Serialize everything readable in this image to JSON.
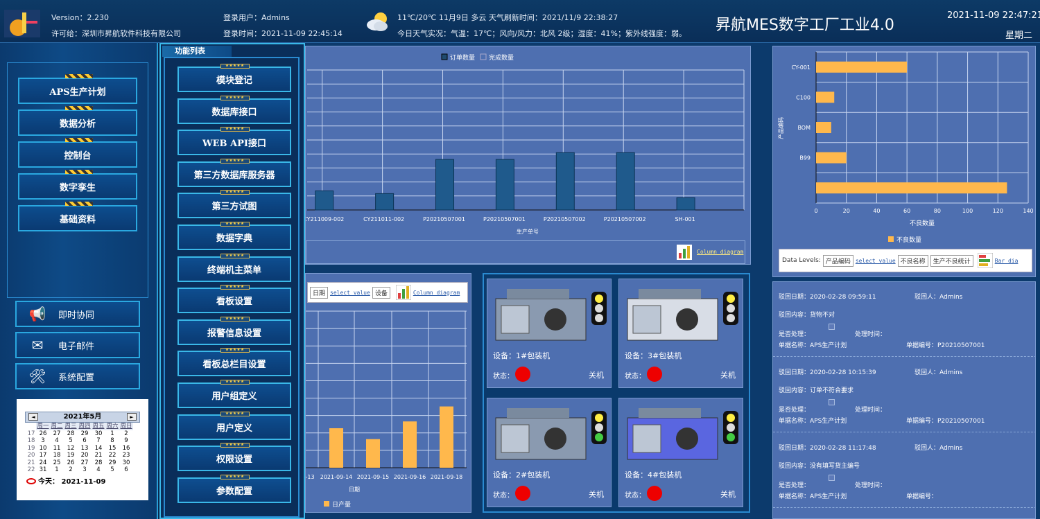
{
  "header": {
    "version": "Version：2.230",
    "license": "许可给：深圳市昇航软件科技有限公司",
    "login_user": "登录用户：Admins",
    "login_time": "登录时间：2021-11-09 22:45:14",
    "weather_line1": "11℃/20℃  11月9日 多云    天气刷新时间：2021/11/9 22:38:27",
    "weather_line2": "今日天气实况：气温：17℃；风向/风力：北风 2级；湿度：41%；紫外线强度：弱。",
    "title": "昇航MES数字工厂工业4.0",
    "datetime": "2021-11-09 22:47:21",
    "weekday": "星期二"
  },
  "left_menu": [
    {
      "label": "APS生产计划"
    },
    {
      "label": "数据分析"
    },
    {
      "label": "控制台"
    },
    {
      "label": "数字孪生"
    },
    {
      "label": "基础资料"
    }
  ],
  "left_actions": [
    {
      "label": "即时协同",
      "icon": "megaphone-icon"
    },
    {
      "label": "电子邮件",
      "icon": "envelope-icon"
    },
    {
      "label": "系统配置",
      "icon": "tools-icon"
    }
  ],
  "calendar": {
    "month_label": "2021年5月",
    "prev": "◄",
    "next": "►",
    "day_headers": [
      "周一",
      "周二",
      "周三",
      "周四",
      "周五",
      "周六",
      "周日"
    ],
    "weeks": [
      {
        "wk": "17",
        "days": [
          "26",
          "27",
          "28",
          "29",
          "30",
          "1",
          "2"
        ]
      },
      {
        "wk": "18",
        "days": [
          "3",
          "4",
          "5",
          "6",
          "7",
          "8",
          "9"
        ]
      },
      {
        "wk": "19",
        "days": [
          "10",
          "11",
          "12",
          "13",
          "14",
          "15",
          "16"
        ]
      },
      {
        "wk": "20",
        "days": [
          "17",
          "18",
          "19",
          "20",
          "21",
          "22",
          "23"
        ]
      },
      {
        "wk": "21",
        "days": [
          "24",
          "25",
          "26",
          "27",
          "28",
          "29",
          "30"
        ]
      },
      {
        "wk": "22",
        "days": [
          "31",
          "1",
          "2",
          "3",
          "4",
          "5",
          "6"
        ]
      }
    ],
    "today": "今天： 2021-11-09"
  },
  "function_list": {
    "title": "功能列表",
    "stars": "★★★★★",
    "items": [
      "模块登记",
      "数据库接口",
      "WEB API接口",
      "第三方数据库服务器",
      "第三方试图",
      "数据字典",
      "终端机主菜单",
      "看板设置",
      "报警信息设置",
      "看板总栏目设置",
      "用户组定义",
      "用户定义",
      "权限设置",
      "参数配置"
    ]
  },
  "order_chart_ui": {
    "column_diagram": "Column diagram"
  },
  "daily_chart_ui": {
    "tags": [
      "日期",
      "select value",
      "设备"
    ],
    "column_diagram": "Column diagram"
  },
  "defect_chart_ui": {
    "data_levels": "Data Levels:",
    "tags": [
      "产品编码",
      "select value",
      "不良名称",
      "生产不良统计"
    ],
    "bar_diagram": "Bar dia"
  },
  "chart_data": [
    {
      "type": "bar",
      "title": "",
      "legend": [
        "订单数量",
        "完成数量"
      ],
      "xlabel": "生产单号",
      "categories": [
        "CY211009-002",
        "CY211011-002",
        "P20210507001",
        "P20210507001",
        "P20210507002",
        "P20210507002",
        "SH-001"
      ],
      "series": [
        {
          "name": "订单数量",
          "values": [
            28,
            24,
            74,
            74,
            84,
            84,
            18
          ]
        }
      ],
      "ylim": [
        0,
        205
      ],
      "color": "#1f5a8c"
    },
    {
      "type": "bar",
      "legend": [
        "日产量"
      ],
      "xlabel": "日期",
      "categories": [
        "2021-09-14",
        "2021-09-15",
        "2021-09-16",
        "2021-09-18"
      ],
      "partial_first_label": "-13",
      "series": [
        {
          "name": "日产量",
          "values": [
            58,
            42,
            68,
            90
          ]
        }
      ],
      "ylim": [
        0,
        230
      ],
      "color": "#ffb84c"
    },
    {
      "type": "bar",
      "orientation": "horizontal",
      "ylabel": "产品编码",
      "xlabel": "不良数量",
      "legend": [
        "不良数量"
      ],
      "categories": [
        "CY-001",
        "C100",
        "BOM",
        "B99",
        ""
      ],
      "series": [
        {
          "name": "不良数量",
          "values": [
            60,
            12,
            10,
            20,
            126
          ]
        }
      ],
      "xlim": [
        0,
        140
      ],
      "xticks": [
        "0",
        "20",
        "40",
        "60",
        "80",
        "100",
        "120",
        "140"
      ],
      "color": "#ffb84c"
    }
  ],
  "devices": [
    {
      "name": "设备：1#包装机",
      "state_label": "状态：",
      "status": "关机"
    },
    {
      "name": "设备：3#包装机",
      "state_label": "状态：",
      "status": "关机"
    },
    {
      "name": "设备：2#包装机",
      "state_label": "状态：",
      "status": "关机"
    },
    {
      "name": "设备：4#包装机",
      "state_label": "状态：",
      "status": "关机"
    }
  ],
  "rejects": [
    {
      "date": "驳回日期：2020-02-28 09:59:11",
      "person": "驳回人：Admins",
      "content": "驳回内容：货物不对",
      "handled": "是否处理：",
      "handle_time": "处理时间：",
      "doc_name": "单据名称：APS生产计划",
      "doc_no": "单据编号：P20210507001"
    },
    {
      "date": "驳回日期：2020-02-28 10:15:39",
      "person": "驳回人：Admins",
      "content": "驳回内容：订单不符合要求",
      "handled": "是否处理：",
      "handle_time": "处理时间：",
      "doc_name": "单据名称：APS生产计划",
      "doc_no": "单据编号：P20210507001"
    },
    {
      "date": "驳回日期：2020-02-28 11:17:48",
      "person": "驳回人：Admins",
      "content": "驳回内容：没有填写货主编号",
      "handled": "是否处理：",
      "handle_time": "处理时间：",
      "doc_name": "单据名称：APS生产计划",
      "doc_no": "单据编号："
    }
  ]
}
